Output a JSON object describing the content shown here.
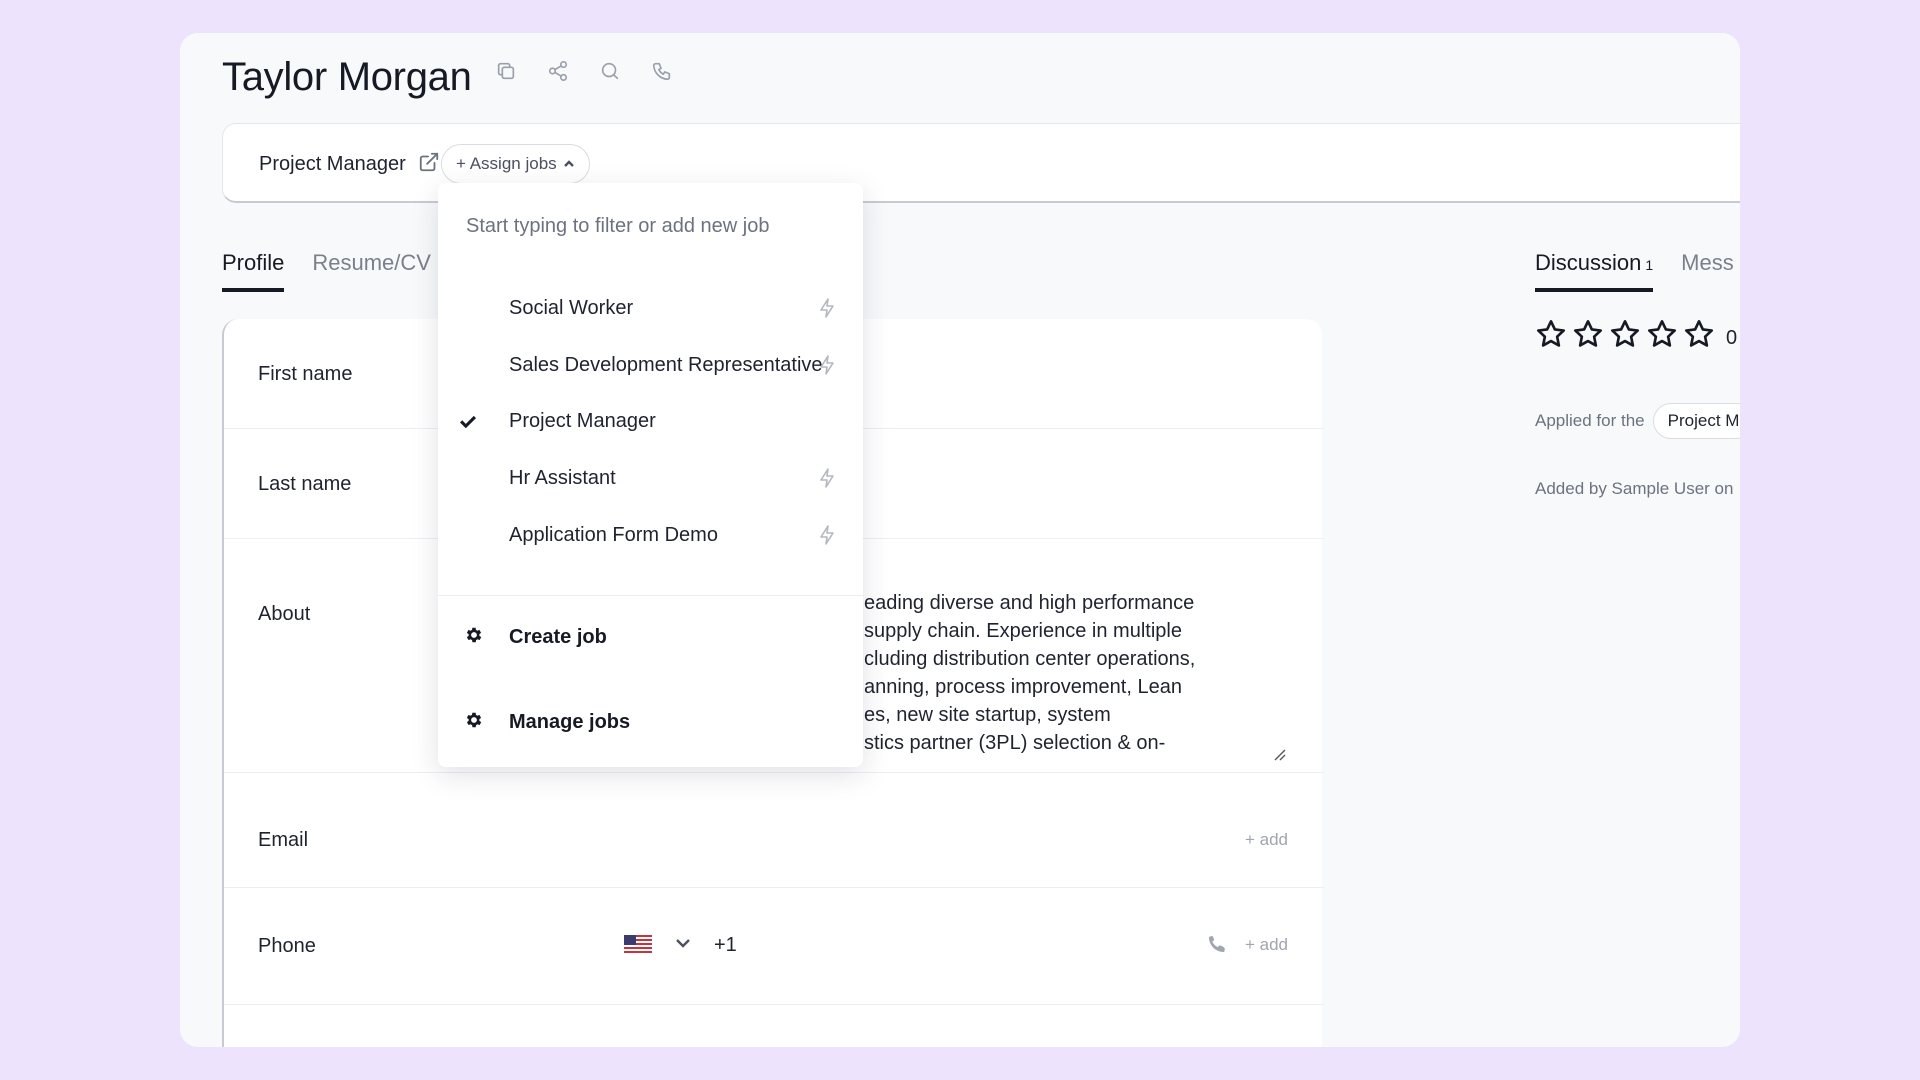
{
  "candidate": {
    "name": "Taylor Morgan"
  },
  "header_icons": [
    "copy-icon",
    "share-icon",
    "search-icon",
    "phone-icon"
  ],
  "jobs_bar": {
    "current_job": "Project Manager",
    "assign_label": "+ Assign jobs"
  },
  "tabs_left": [
    {
      "label": "Profile",
      "active": true
    },
    {
      "label": "Resume/CV",
      "active": false
    }
  ],
  "form": {
    "first_name_label": "First name",
    "last_name_label": "Last name",
    "about_label": "About",
    "about_text": "eading diverse and high performance\n supply chain. Experience in multiple\ncluding distribution center operations,\nanning, process improvement, Lean\nes, new site startup, system\nstics partner (3PL) selection & on-",
    "email_label": "Email",
    "email_add": "+ add",
    "phone_label": "Phone",
    "phone_code": "+1",
    "phone_add": "+ add"
  },
  "tabs_right": [
    {
      "label": "Discussion",
      "count": "1",
      "active": true
    },
    {
      "label": "Mess",
      "count": "",
      "active": false
    }
  ],
  "rating": {
    "value": 0,
    "max": 5,
    "count_text": "0"
  },
  "applied": {
    "prefix": "Applied for the",
    "job_pill": "Project M"
  },
  "added_by": "Added by Sample User on",
  "dropdown": {
    "filter_placeholder": "Start typing to filter or add new job",
    "items": [
      {
        "label": "Social Worker",
        "selected": false
      },
      {
        "label": "Sales Development Representative",
        "selected": false
      },
      {
        "label": "Project Manager",
        "selected": true
      },
      {
        "label": "Hr Assistant",
        "selected": false
      },
      {
        "label": "Application Form Demo",
        "selected": false
      }
    ],
    "create_label": "Create job",
    "manage_label": "Manage jobs"
  },
  "colors": {
    "background": "#ede3fc",
    "text": "#161a24",
    "muted": "#6b7280"
  }
}
